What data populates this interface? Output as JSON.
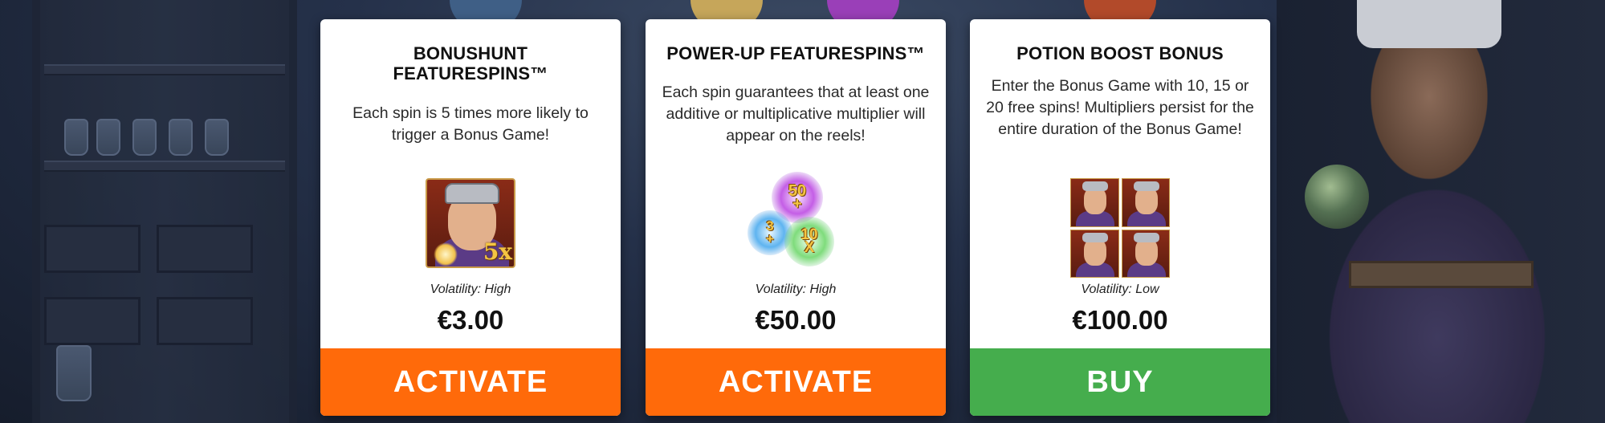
{
  "cards": [
    {
      "title": "BONUSHUNT FEATURESPINS™",
      "description": "Each spin is 5 times more likely to trigger a Bonus Game!",
      "symbol_icon": "wizard-5x-symbol",
      "symbol_multiplier": "5x",
      "volatility": "Volatility: High",
      "price": "€3.00",
      "button_label": "ACTIVATE",
      "button_color": "#ff6a0a"
    },
    {
      "title": "POWER-UP FEATURESPINS™",
      "description": "Each spin guarantees that at least one additive or multiplicative multiplier will appear on the reels!",
      "symbol_icon": "multiplier-orbs-symbol",
      "orbs": [
        {
          "top": "50",
          "bottom": "+"
        },
        {
          "top": "3",
          "bottom": "+"
        },
        {
          "top": "10",
          "bottom": "X"
        }
      ],
      "volatility": "Volatility: High",
      "price": "€50.00",
      "button_label": "ACTIVATE",
      "button_color": "#ff6a0a"
    },
    {
      "title": "POTION BOOST BONUS",
      "description": "Enter the Bonus Game with 10, 15 or 20 free spins! Multipliers persist for the entire duration of the Bonus Game!",
      "symbol_icon": "wizard-grid-symbol",
      "volatility": "Volatility: Low",
      "price": "€100.00",
      "button_label": "BUY",
      "button_color": "#45ad4d"
    }
  ]
}
